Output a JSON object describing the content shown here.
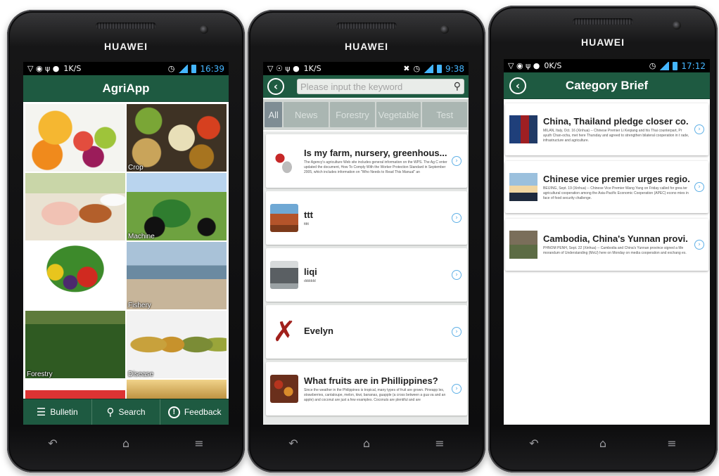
{
  "phones": [
    {
      "brand": "HUAWEI",
      "status": {
        "speed": "1K/S",
        "time": "16:39"
      },
      "title": "AgriApp",
      "tiles": [
        {
          "label": ""
        },
        {
          "label": "Crop"
        },
        {
          "label": ""
        },
        {
          "label": "Machine"
        },
        {
          "label": ""
        },
        {
          "label": "Fishery"
        },
        {
          "label": "Forestry"
        },
        {
          "label": "Disease"
        },
        {
          "label": ""
        },
        {
          "label": ""
        }
      ],
      "tabs": [
        {
          "label": "Bulletin",
          "icon": "list-icon"
        },
        {
          "label": "Search",
          "icon": "search-icon"
        },
        {
          "label": "Feedback",
          "icon": "exclamation-icon"
        }
      ]
    },
    {
      "brand": "HUAWEI",
      "status": {
        "speed": "1K/S",
        "time": "9:38"
      },
      "search_placeholder": "Please input the keyword",
      "categories": [
        "All",
        "News",
        "Forestry",
        "Vegetable",
        "Test"
      ],
      "items": [
        {
          "title": "Is my farm, nursery, greenhous...",
          "desc": "The Agency's agriculture Web site includes general information on the WPS. The Ag C enter updated the document, How To Comply With the Worker Protection Standard in September 2005, which includes information on \"Who Needs to Read This Manual\" an"
        },
        {
          "title": "ttt",
          "desc": "ttttt"
        },
        {
          "title": "liqi",
          "desc": "dddddd"
        },
        {
          "title": "Evelyn",
          "desc": ""
        },
        {
          "title": "What fruits are in Phillippines?",
          "desc": "Since the weather in the Philippines is tropical, many types of fruit are grown. Pineapp les, strawberries, cantaloupe, melon, kiwi, bananas, guapple (a cross between a gua va and an apple) and coconut are just a few examples. Coconuts are plentiful and are"
        }
      ]
    },
    {
      "brand": "HUAWEI",
      "status": {
        "speed": "0K/S",
        "time": "17:12"
      },
      "title": "Category Brief",
      "items": [
        {
          "title": "China, Thailand pledge closer co.",
          "desc": "MILAN, Italy, Oct. 16 (Xinhua) -- Chinese Premier Li Keqiang and his Thai counterpart, Pr ayuth Chan-ocha, met here Thursday and agreed to strengthen bilateral cooperation in t rade, infrastructure and agriculture."
        },
        {
          "title": "Chinese vice premier urges regio.",
          "desc": "BEIJING, Sept. 19 (Xinhua) -- Chinese Vice Premier Wang Yang on Friday called for grea ter agricultural cooperation among the Asia-Pacific Economic Cooperation (APEC) econo mies in face of food security challenge."
        },
        {
          "title": "Cambodia, China's Yunnan provi.",
          "desc": "PHNOM PENH, Sept. 22 (Xinhua) -- Cambodia and China's Yunnan province signed a Me morandum of Understanding (MoU) here on Monday on media cooperation and exchang es."
        }
      ]
    }
  ]
}
